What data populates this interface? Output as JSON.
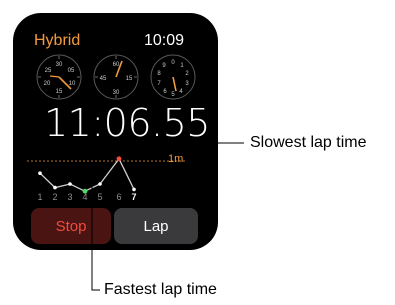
{
  "watch": {
    "mode_title": "Hybrid",
    "clock_time": "10:09",
    "elapsed_time": "11:06.55",
    "graph_scale": "1m",
    "lap_numbers": [
      "1",
      "2",
      "3",
      "4",
      "5",
      "6",
      "7"
    ],
    "current_lap": "7",
    "stop_label": "Stop",
    "lap_label": "Lap",
    "accent_color": "#f19a3e",
    "dials": [
      {
        "name": "hours-subdial",
        "ticks": [
          "30",
          "05",
          "25",
          "10",
          "20",
          "15"
        ]
      },
      {
        "name": "seconds-subdial",
        "ticks": [
          "60",
          "45",
          "15",
          "30"
        ]
      },
      {
        "name": "tenths-subdial",
        "ticks": [
          "0",
          "1",
          "9",
          "2",
          "8",
          "3",
          "7",
          "4",
          "6",
          "5"
        ]
      }
    ],
    "lap_times_relative": [
      0.55,
      0.15,
      0.25,
      0.05,
      0.25,
      0.95,
      0.1
    ],
    "slowest_lap_index": 5,
    "fastest_lap_index": 3
  },
  "callouts": {
    "slowest": "Slowest lap time",
    "fastest": "Fastest lap time"
  }
}
